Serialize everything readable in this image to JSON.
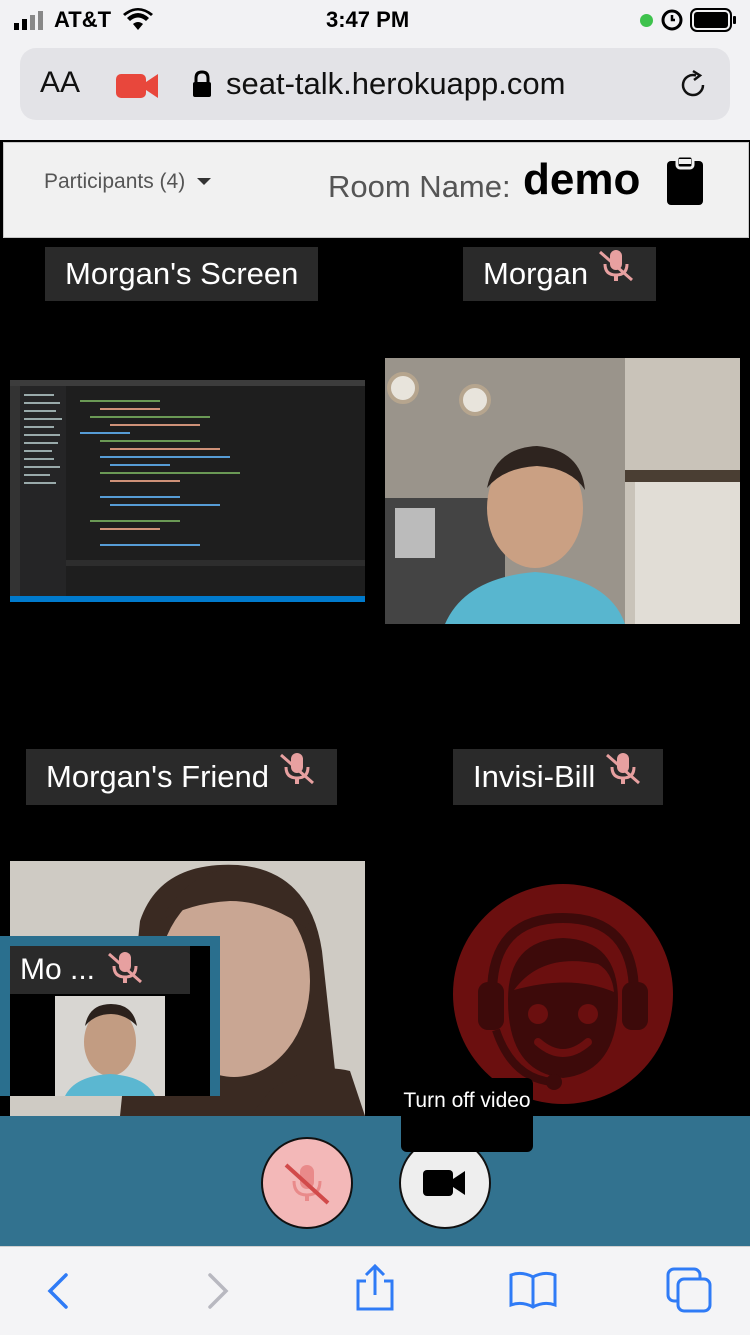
{
  "status": {
    "carrier": "AT&T",
    "time": "3:47 PM"
  },
  "safari": {
    "text_size": "AA",
    "url": "seat-talk.herokuapp.com"
  },
  "header": {
    "participants_label": "Participants (4)",
    "room_prefix": "Room Name:",
    "room_name": "demo"
  },
  "tiles": [
    {
      "label": "Morgan's Screen",
      "muted": false
    },
    {
      "label": "Morgan",
      "muted": true
    },
    {
      "label": "Morgan's Friend",
      "muted": true
    },
    {
      "label": "Invisi-Bill",
      "muted": true
    }
  ],
  "self_view": {
    "label": "Mo ...",
    "muted": true
  },
  "controls": {
    "tooltip": "Turn off video"
  },
  "colors": {
    "control_bar": "#32728f",
    "mute_pink": "#f3b8b8",
    "avatar_red": "#6b0f0f"
  }
}
